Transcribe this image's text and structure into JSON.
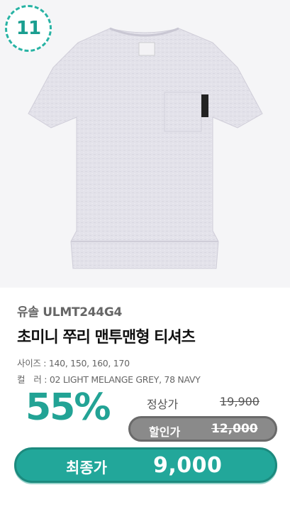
{
  "badge": {
    "number": "11"
  },
  "product": {
    "brand_code": "유솔 ULMT244G4",
    "name": "초미니 쭈리 맨투맨형 티셔츠",
    "sizes": "사이즈 : 140, 150, 160, 170",
    "colors": "컬　러 : 02 LIGHT MELANGE GREY, 78 NAVY",
    "image": "light-grey-tshirt-image"
  },
  "pricing": {
    "discount": "55%",
    "regular_label": "정상가",
    "regular_price": "19,900",
    "sale_label": "할인가",
    "sale_price": "12,000",
    "final_label": "최종가",
    "final_price": "9,000"
  },
  "colors": {
    "accent": "#22a79a",
    "sale_pill": "#8a8a8a",
    "image_bg": "#f5f5f7"
  }
}
